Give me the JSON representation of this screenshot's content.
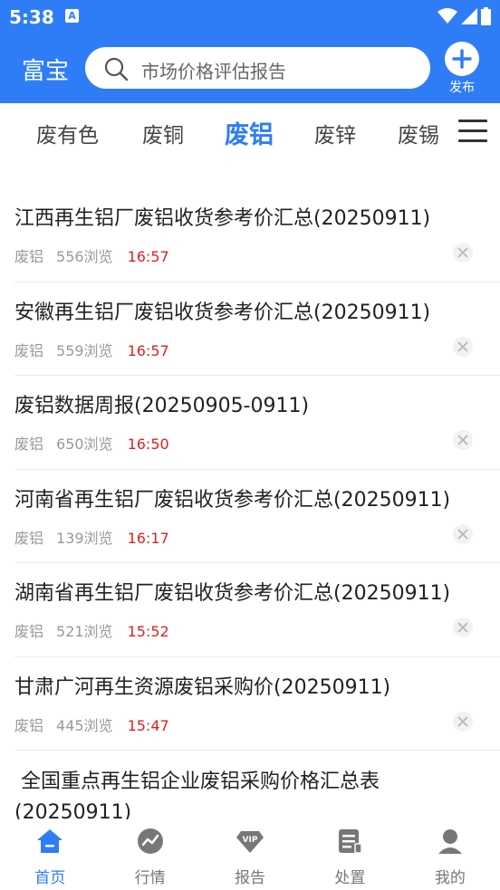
{
  "status_bar": {
    "time": "5:38",
    "notification_badge": "A"
  },
  "header": {
    "title": "富宝",
    "search_placeholder": "市场价格评估报告",
    "publish_label": "发布",
    "accent_color": "#2f7df6"
  },
  "categories": {
    "tabs": [
      "废有色",
      "废铜",
      "废铝",
      "废锌",
      "废锡"
    ],
    "active": "废铝"
  },
  "articles": [
    {
      "title": "江西再生铝厂废铝收货参考价汇总(20250911)",
      "category": "废铝",
      "views": "556浏览",
      "time": "16:57"
    },
    {
      "title": "安徽再生铝厂废铝收货参考价汇总(20250911)",
      "category": "废铝",
      "views": "559浏览",
      "time": "16:57"
    },
    {
      "title": "废铝数据周报(20250905-0911)",
      "category": "废铝",
      "views": "650浏览",
      "time": "16:50"
    },
    {
      "title": "河南省再生铝厂废铝收货参考价汇总(20250911)",
      "category": "废铝",
      "views": "139浏览",
      "time": "16:17"
    },
    {
      "title": "湖南省再生铝厂废铝收货参考价汇总(20250911)",
      "category": "废铝",
      "views": "521浏览",
      "time": "15:52"
    },
    {
      "title": "甘肃广河再生资源废铝采购价(20250911)",
      "category": "废铝",
      "views": "445浏览",
      "time": "15:47"
    }
  ],
  "partial_article": {
    "line1": " 全国重点再生铝企业废铝采购价格汇总表",
    "line2": "(20250911)"
  },
  "bottom_nav": [
    {
      "label": "首页",
      "icon": "home-icon",
      "active": true
    },
    {
      "label": "行情",
      "icon": "trend-icon",
      "active": false
    },
    {
      "label": "报告",
      "icon": "vip-diamond-icon",
      "active": false
    },
    {
      "label": "处置",
      "icon": "document-icon",
      "active": false
    },
    {
      "label": "我的",
      "icon": "profile-icon",
      "active": false
    }
  ]
}
